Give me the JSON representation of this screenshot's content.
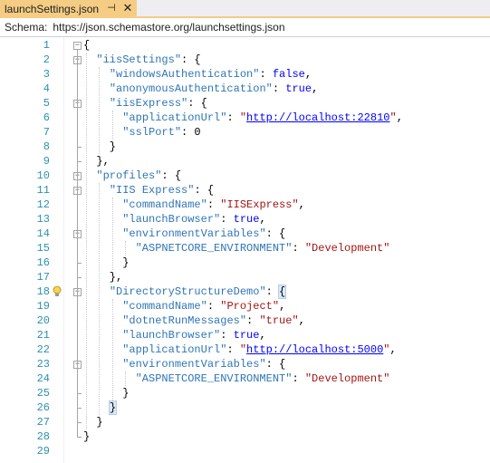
{
  "tab": {
    "title": "launchSettings.json",
    "pin_glyph": "⊣",
    "close_glyph": "✕"
  },
  "schema": {
    "label": "Schema:",
    "value": "https://json.schemastore.org/launchsettings.json"
  },
  "lines": [
    {
      "n": "1",
      "t": [
        [
          "p",
          "{"
        ]
      ]
    },
    {
      "n": "2",
      "t": [
        [
          "p",
          "  "
        ],
        [
          "k",
          "\"iisSettings\""
        ],
        [
          "p",
          ": {"
        ]
      ]
    },
    {
      "n": "3",
      "t": [
        [
          "p",
          "    "
        ],
        [
          "k",
          "\"windowsAuthentication\""
        ],
        [
          "p",
          ": "
        ],
        [
          "kw",
          "false"
        ],
        [
          "p",
          ","
        ]
      ]
    },
    {
      "n": "4",
      "t": [
        [
          "p",
          "    "
        ],
        [
          "k",
          "\"anonymousAuthentication\""
        ],
        [
          "p",
          ": "
        ],
        [
          "kw",
          "true"
        ],
        [
          "p",
          ","
        ]
      ]
    },
    {
      "n": "5",
      "t": [
        [
          "p",
          "    "
        ],
        [
          "k",
          "\"iisExpress\""
        ],
        [
          "p",
          ": {"
        ]
      ]
    },
    {
      "n": "6",
      "t": [
        [
          "p",
          "      "
        ],
        [
          "k",
          "\"applicationUrl\""
        ],
        [
          "p",
          ": "
        ],
        [
          "s",
          "\""
        ],
        [
          "url",
          "http://localhost:22810"
        ],
        [
          "s",
          "\""
        ],
        [
          "p",
          ","
        ]
      ]
    },
    {
      "n": "7",
      "t": [
        [
          "p",
          "      "
        ],
        [
          "k",
          "\"sslPort\""
        ],
        [
          "p",
          ": 0"
        ]
      ]
    },
    {
      "n": "8",
      "t": [
        [
          "p",
          "    }"
        ]
      ]
    },
    {
      "n": "9",
      "t": [
        [
          "p",
          "  },"
        ]
      ]
    },
    {
      "n": "10",
      "t": [
        [
          "p",
          "  "
        ],
        [
          "k",
          "\"profiles\""
        ],
        [
          "p",
          ": {"
        ]
      ]
    },
    {
      "n": "11",
      "t": [
        [
          "p",
          "    "
        ],
        [
          "k",
          "\"IIS Express\""
        ],
        [
          "p",
          ": {"
        ]
      ]
    },
    {
      "n": "12",
      "t": [
        [
          "p",
          "      "
        ],
        [
          "k",
          "\"commandName\""
        ],
        [
          "p",
          ": "
        ],
        [
          "s",
          "\"IISExpress\""
        ],
        [
          "p",
          ","
        ]
      ]
    },
    {
      "n": "13",
      "t": [
        [
          "p",
          "      "
        ],
        [
          "k",
          "\"launchBrowser\""
        ],
        [
          "p",
          ": "
        ],
        [
          "kw",
          "true"
        ],
        [
          "p",
          ","
        ]
      ]
    },
    {
      "n": "14",
      "t": [
        [
          "p",
          "      "
        ],
        [
          "k",
          "\"environmentVariables\""
        ],
        [
          "p",
          ": {"
        ]
      ]
    },
    {
      "n": "15",
      "t": [
        [
          "p",
          "        "
        ],
        [
          "k",
          "\"ASPNETCORE_ENVIRONMENT\""
        ],
        [
          "p",
          ": "
        ],
        [
          "s",
          "\"Development\""
        ]
      ]
    },
    {
      "n": "16",
      "t": [
        [
          "p",
          "      }"
        ]
      ]
    },
    {
      "n": "17",
      "t": [
        [
          "p",
          "    },"
        ]
      ]
    },
    {
      "n": "18",
      "t": [
        [
          "p",
          "    "
        ],
        [
          "k",
          "\"DirectoryStructureDemo\""
        ],
        [
          "p",
          ": "
        ],
        [
          "hl",
          "{"
        ]
      ]
    },
    {
      "n": "19",
      "t": [
        [
          "p",
          "      "
        ],
        [
          "k",
          "\"commandName\""
        ],
        [
          "p",
          ": "
        ],
        [
          "s",
          "\"Project\""
        ],
        [
          "p",
          ","
        ]
      ]
    },
    {
      "n": "20",
      "t": [
        [
          "p",
          "      "
        ],
        [
          "k",
          "\"dotnetRunMessages\""
        ],
        [
          "p",
          ": "
        ],
        [
          "s",
          "\"true\""
        ],
        [
          "p",
          ","
        ]
      ]
    },
    {
      "n": "21",
      "t": [
        [
          "p",
          "      "
        ],
        [
          "k",
          "\"launchBrowser\""
        ],
        [
          "p",
          ": "
        ],
        [
          "kw",
          "true"
        ],
        [
          "p",
          ","
        ]
      ]
    },
    {
      "n": "22",
      "t": [
        [
          "p",
          "      "
        ],
        [
          "k",
          "\"applicationUrl\""
        ],
        [
          "p",
          ": "
        ],
        [
          "s",
          "\""
        ],
        [
          "url",
          "http://localhost:5000"
        ],
        [
          "s",
          "\""
        ],
        [
          "p",
          ","
        ]
      ]
    },
    {
      "n": "23",
      "t": [
        [
          "p",
          "      "
        ],
        [
          "k",
          "\"environmentVariables\""
        ],
        [
          "p",
          ": {"
        ]
      ]
    },
    {
      "n": "24",
      "t": [
        [
          "p",
          "        "
        ],
        [
          "k",
          "\"ASPNETCORE_ENVIRONMENT\""
        ],
        [
          "p",
          ": "
        ],
        [
          "s",
          "\"Development\""
        ]
      ]
    },
    {
      "n": "25",
      "t": [
        [
          "p",
          "      }"
        ]
      ]
    },
    {
      "n": "26",
      "t": [
        [
          "p",
          "    "
        ],
        [
          "hl",
          "}"
        ]
      ]
    },
    {
      "n": "27",
      "t": [
        [
          "p",
          "  }"
        ]
      ]
    },
    {
      "n": "28",
      "t": [
        [
          "p",
          "}"
        ]
      ]
    },
    {
      "n": "29",
      "t": []
    }
  ],
  "lightbulb_line": "18",
  "colors": {
    "tab_active": "#f5cc84",
    "line_number": "#2b91af",
    "json_key": "#2e75b6",
    "json_string": "#a31515",
    "json_keyword": "#0000ff"
  }
}
